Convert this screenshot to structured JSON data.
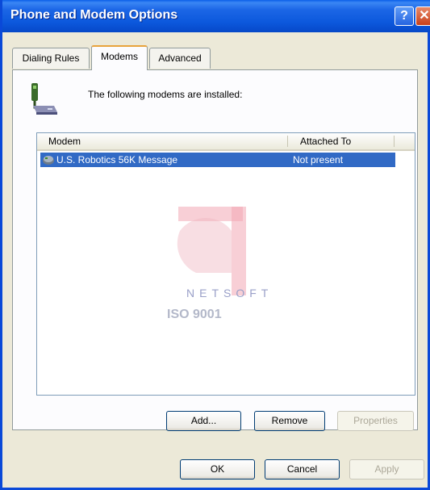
{
  "window": {
    "title": "Phone and Modem Options"
  },
  "titlebar": {
    "help_glyph": "?",
    "close_glyph": "✕"
  },
  "tabs": [
    {
      "label": "Dialing Rules",
      "active": false
    },
    {
      "label": "Modems",
      "active": true
    },
    {
      "label": "Advanced",
      "active": false
    }
  ],
  "intro": {
    "text": "The following modems are installed:"
  },
  "list": {
    "columns": [
      "Modem",
      "Attached To"
    ],
    "rows": [
      {
        "modem": "U.S. Robotics 56K Message",
        "attached_to": "Not present",
        "selected": true
      }
    ]
  },
  "watermark": {
    "brand": "NETSOFT",
    "certification": "ISO 9001"
  },
  "panel_buttons": {
    "add": "Add...",
    "remove": "Remove",
    "properties": "Properties"
  },
  "dialog_buttons": {
    "ok": "OK",
    "cancel": "Cancel",
    "apply": "Apply"
  },
  "colors": {
    "titlebar": "#0c58dc",
    "selection": "#316ac5",
    "dialog_bg": "#ece9d8",
    "tab_highlight": "#e8a33c"
  },
  "icons": {
    "header": "phone-modem-icon",
    "row": "modem-icon",
    "help": "help-icon",
    "close": "close-icon"
  }
}
